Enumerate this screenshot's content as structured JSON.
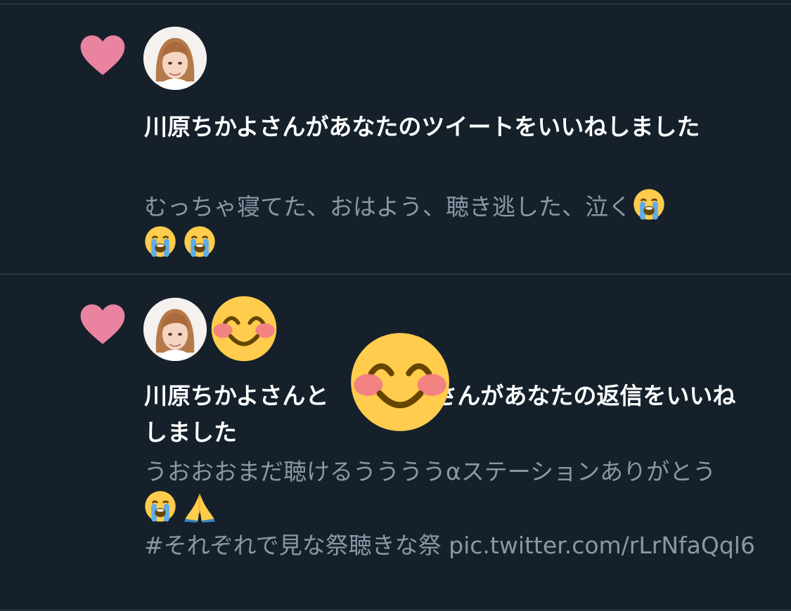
{
  "colors": {
    "background": "#15202b",
    "divider": "#38444d",
    "heart": "#e9839f",
    "headline": "#ffffff",
    "tweet_text": "#8899a6"
  },
  "notifications": [
    {
      "icon": "heart-icon",
      "headline": "川原ちかよさんがあなたのツイートをいいねしました",
      "tweet_text": "むっちゃ寝てた、おはよう、聴き逃した、泣く",
      "tweet_emojis": [
        "loudly-crying-face",
        "loudly-crying-face",
        "loudly-crying-face"
      ]
    },
    {
      "icon": "heart-icon",
      "headline_part1": "川原ちかよさんと",
      "headline_part2": "さんがあなたの返信をいいねしました",
      "tweet_text": "うおおおまだ聴けるううううαステーションありがとう",
      "tweet_emojis": [
        "loudly-crying-face",
        "folded-hands"
      ],
      "tweet_text_2": "#それぞれで見な祭聴きな祭 pic.twitter.com/rLrNfaQql6"
    }
  ]
}
